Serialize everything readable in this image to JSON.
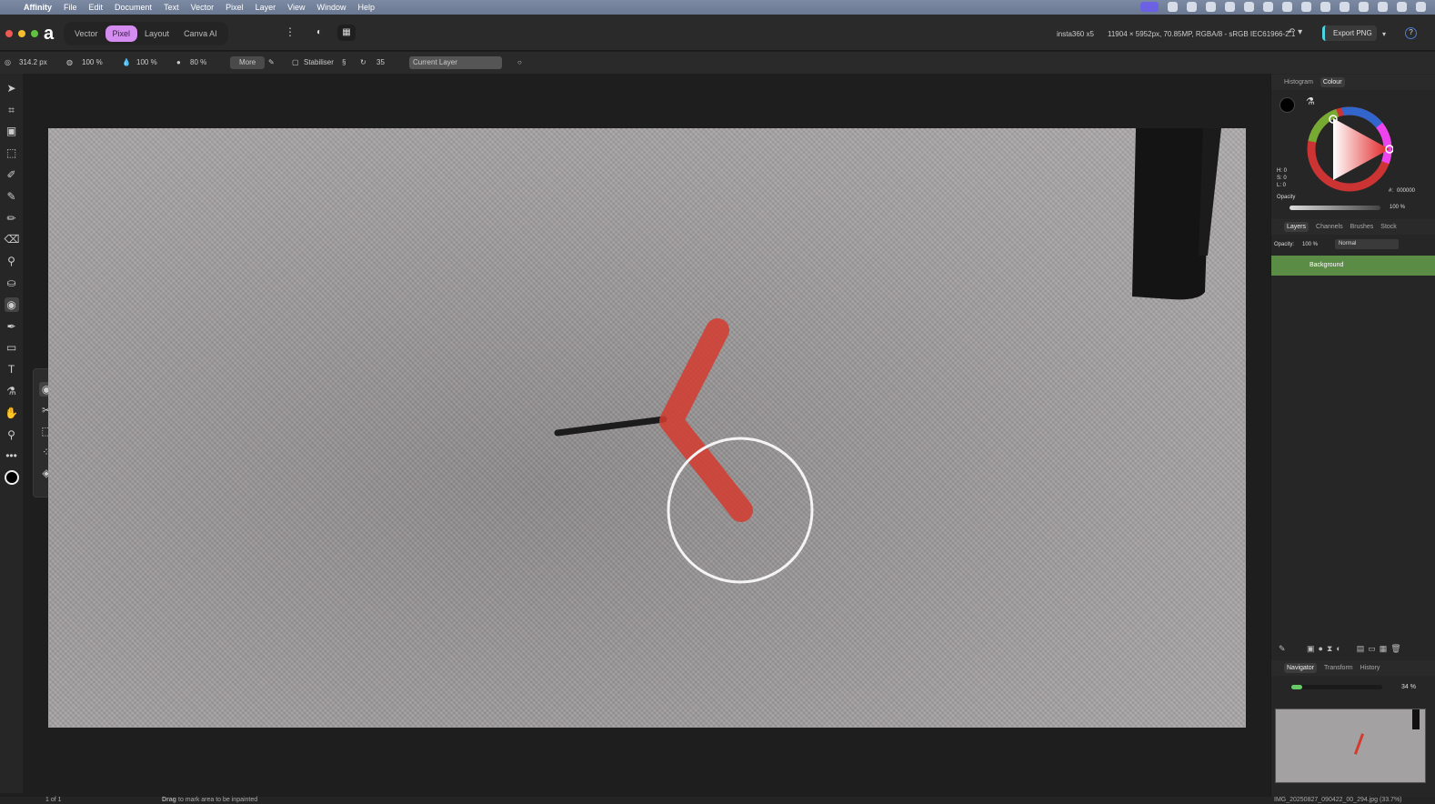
{
  "menubar": {
    "app": "Affinity",
    "items": [
      "File",
      "Edit",
      "Document",
      "Text",
      "Vector",
      "Pixel",
      "Layer",
      "View",
      "Window",
      "Help"
    ]
  },
  "toolbar": {
    "personas": [
      "Vector",
      "Pixel",
      "Layout",
      "Canva AI"
    ],
    "active_persona": "Pixel",
    "camera": "insta360 x5",
    "doc_info": "11904 × 5952px, 70.85MP, RGBA/8 - sRGB IEC61966-2.1",
    "export_label": "Export PNG",
    "help": "?"
  },
  "context": {
    "width": "314.2 px",
    "opacity": "100 %",
    "flow": "100 %",
    "hardness": "80 %",
    "more": "More",
    "stabiliser": "Stabiliser",
    "stab_value": "35",
    "source": "Current Layer"
  },
  "colour_panel": {
    "tabs": [
      "Histogram",
      "Colour"
    ],
    "active": "Colour",
    "h": "H: 0",
    "s": "S: 0",
    "l": "L: 0",
    "hex_label": "#:",
    "hex": "000000",
    "opacity_label": "Opacity",
    "opacity": "100 %"
  },
  "layers_panel": {
    "tabs": [
      "Layers",
      "Channels",
      "Brushes",
      "Stock"
    ],
    "opacity_label": "Opacity:",
    "opacity": "100 %",
    "blend": "Normal",
    "layers": [
      {
        "name": "Background"
      }
    ]
  },
  "navigator": {
    "tabs": [
      "Navigator",
      "Transform",
      "History"
    ],
    "zoom": "34 %",
    "zoom_fraction": 0.1
  },
  "status": {
    "page": "1 of 1",
    "hint_bold": "Drag",
    "hint": "to mark area to be inpainted",
    "filename": "IMG_20250827_090422_00_294.jpg (33.7%)"
  }
}
